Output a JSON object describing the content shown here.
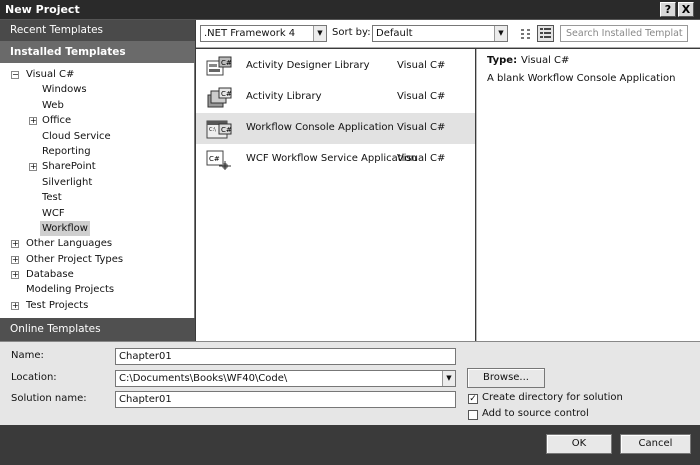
{
  "window": {
    "title": "New Project",
    "help_glyph": "?",
    "close_glyph": "X"
  },
  "left": {
    "recent_templates": "Recent Templates",
    "installed_templates": "Installed Templates",
    "online_templates": "Online Templates",
    "tree": [
      {
        "label": "Visual C#",
        "level": 0,
        "expander": "minus"
      },
      {
        "label": "Windows",
        "level": 1,
        "expander": "none"
      },
      {
        "label": "Web",
        "level": 1,
        "expander": "none"
      },
      {
        "label": "Office",
        "level": 1,
        "expander": "plus"
      },
      {
        "label": "Cloud Service",
        "level": 1,
        "expander": "none"
      },
      {
        "label": "Reporting",
        "level": 1,
        "expander": "none"
      },
      {
        "label": "SharePoint",
        "level": 1,
        "expander": "plus"
      },
      {
        "label": "Silverlight",
        "level": 1,
        "expander": "none"
      },
      {
        "label": "Test",
        "level": 1,
        "expander": "none"
      },
      {
        "label": "WCF",
        "level": 1,
        "expander": "none"
      },
      {
        "label": "Workflow",
        "level": 1,
        "expander": "none",
        "selected": true
      },
      {
        "label": "Other Languages",
        "level": 0,
        "expander": "plus"
      },
      {
        "label": "Other Project Types",
        "level": 0,
        "expander": "plus"
      },
      {
        "label": "Database",
        "level": 0,
        "expander": "plus"
      },
      {
        "label": "Modeling Projects",
        "level": 0,
        "expander": "none"
      },
      {
        "label": "Test Projects",
        "level": 0,
        "expander": "plus"
      }
    ]
  },
  "toolbar": {
    "framework": ".NET Framework 4",
    "sort_label": "Sort by:",
    "sort_value": "Default",
    "search_placeholder": "Search Installed Templat"
  },
  "templates": [
    {
      "name": "Activity Designer Library",
      "language": "Visual C#",
      "icon": "activity-designer-icon"
    },
    {
      "name": "Activity Library",
      "language": "Visual C#",
      "icon": "activity-library-icon"
    },
    {
      "name": "Workflow Console Application",
      "language": "Visual C#",
      "icon": "workflow-console-icon",
      "selected": true
    },
    {
      "name": "WCF Workflow Service Application",
      "language": "Visual C#",
      "icon": "wcf-workflow-icon"
    }
  ],
  "details": {
    "type_label": "Type:",
    "type_value": "Visual C#",
    "description": "A blank Workflow Console Application"
  },
  "form": {
    "name_label": "Name:",
    "name_value": "Chapter01",
    "location_label": "Location:",
    "location_value": "C:\\Documents\\Books\\WF40\\Code\\",
    "solution_label": "Solution name:",
    "solution_value": "Chapter01",
    "browse": "Browse...",
    "create_dir_label": "Create directory for solution",
    "create_dir_checked": true,
    "source_control_label": "Add to source control",
    "source_control_checked": false
  },
  "buttons": {
    "ok": "OK",
    "cancel": "Cancel"
  }
}
